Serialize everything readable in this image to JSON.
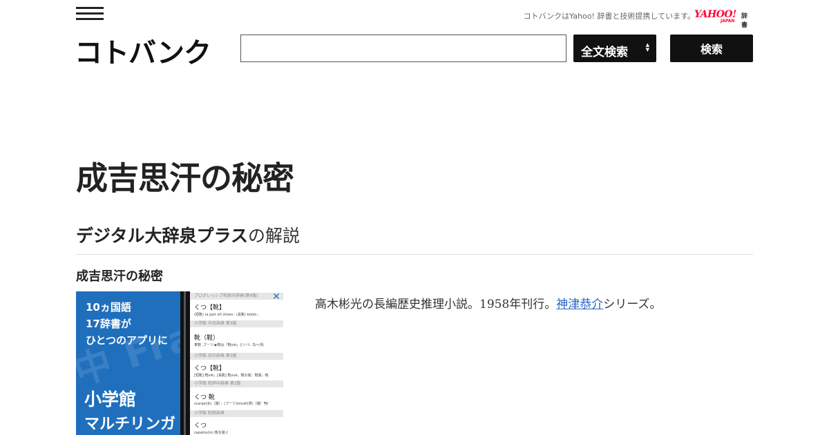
{
  "header": {
    "menu_icon": "hamburger-menu-icon",
    "partner_note": "コトバンクはYahoo! 辞書と技術提携しています。",
    "yahoo_logo": {
      "main": "YAHOO!",
      "sub": "JAPAN",
      "suffix": "辞書",
      "color": "#ff0033"
    },
    "site_logo": "コトバンク",
    "search": {
      "input_value": "",
      "input_placeholder": "",
      "select_selected": "全文検索",
      "button_label": "検索"
    }
  },
  "main": {
    "page_title": "成吉思汗の秘密",
    "section": {
      "source_name": "デジタル大辞泉プラス",
      "source_suffix": "の解説"
    },
    "entry_heading": "成吉思汗の秘密",
    "definition": {
      "text_before": "高木彬光の長編歴史推理小説。1958年刊行。",
      "link_text": "神津恭介",
      "text_after": "シリーズ。"
    }
  },
  "ad": {
    "line1": "10ヵ国語",
    "line2": "17辞書が",
    "line3": "ひとつのアプリに",
    "brand_line1": "小学館",
    "brand_line2": "マルチリンガル",
    "watermark": "中 Fran",
    "close_icon": "close-icon",
    "rows": [
      {
        "head": "プログレッシブ和英中辞典(第4版)",
        "word": "くつ【靴】",
        "def": "(短靴) (a pair of) shoes ; (長靴) boots ;"
      },
      {
        "head": "小学館 中日辞典 第3版",
        "word": "靴（鞋）",
        "def": "革鞋 ,ブーツ ▶鞋は「鞋xié」という. 鸟〜/鳥"
      },
      {
        "head": "小学館 日中辞典 第3版",
        "word": "くつ【靴】",
        "def": "[短靴] 鞋xié；[長靴] 靴xuē。靴の底：鞋底。靴"
      },
      {
        "head": "小学館 和伊中辞典 第2版",
        "word": "くつ 靴",
        "def": "scarpe(女)［複］：(ブーツ)stivali(男)［複］¶R"
      },
      {
        "head": "小学館 和西辞典",
        "word": "くつ",
        "def": "zapatos(m) 靴を脱ぐ"
      }
    ],
    "brand_color": "#1f6fbd"
  }
}
